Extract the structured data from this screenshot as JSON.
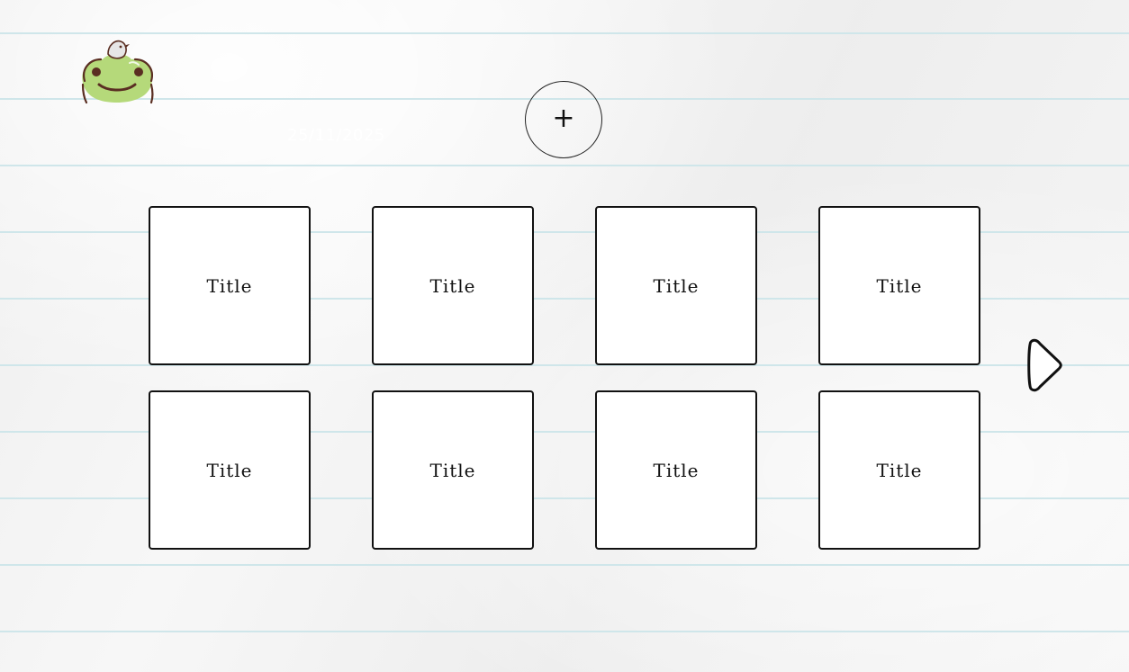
{
  "header": {
    "date": "25/11/2025",
    "add_button_label": "+"
  },
  "icons": {
    "logo": "frog-icon",
    "next": "next-arrow-icon"
  },
  "cards": [
    {
      "title": "Title"
    },
    {
      "title": "Title"
    },
    {
      "title": "Title"
    },
    {
      "title": "Title"
    },
    {
      "title": "Title"
    },
    {
      "title": "Title"
    },
    {
      "title": "Title"
    },
    {
      "title": "Title"
    }
  ],
  "colors": {
    "paper": "#f2f2f2",
    "rule_line": "#cfe6ea",
    "frog_green": "#b5d97a",
    "ink": "#111111"
  }
}
